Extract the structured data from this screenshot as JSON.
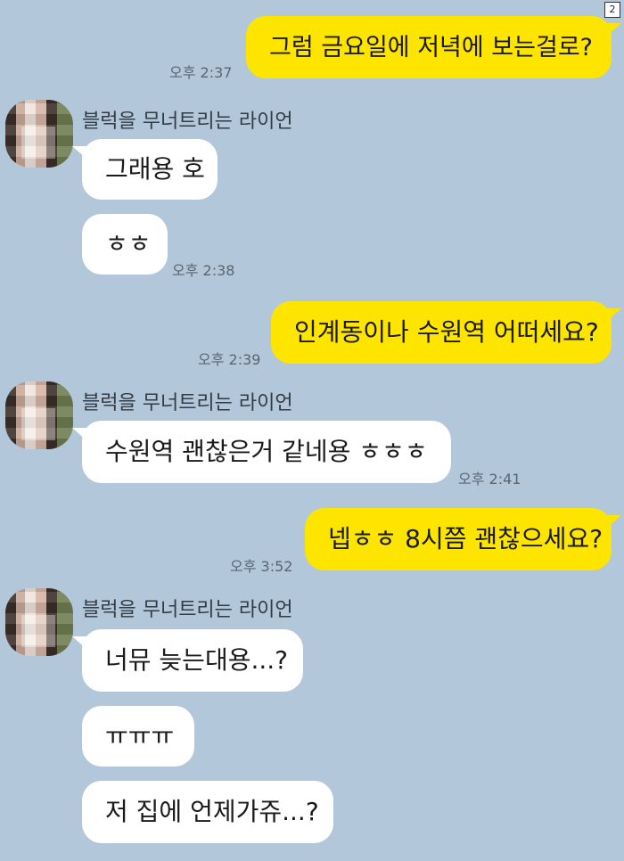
{
  "page_badge": "2",
  "sender_name": "블럭을 무너트리는 라이언",
  "messages": [
    {
      "text": "그럼 금요일에 저녁에 보는걸로?",
      "time": "오후 2:37"
    },
    {
      "text": "그래용 호"
    },
    {
      "text": "ㅎㅎ",
      "time": "오후 2:38"
    },
    {
      "text": "인계동이나 수원역 어떠세요?",
      "time": "오후 2:39"
    },
    {
      "text": "수원역 괜찮은거 같네용 ㅎㅎㅎ",
      "time": "오후 2:41"
    },
    {
      "text": "넵ㅎㅎ 8시쯤 괜찮으세요?",
      "time": "오후 3:52"
    },
    {
      "text": "너뮤 늦는대용...?"
    },
    {
      "text": "ㅠㅠㅠ"
    },
    {
      "text": "저 집에 언제가쥬...?"
    }
  ],
  "colors": {
    "background": "#b2c7da",
    "my_bubble": "#fee500",
    "their_bubble": "#ffffff"
  }
}
